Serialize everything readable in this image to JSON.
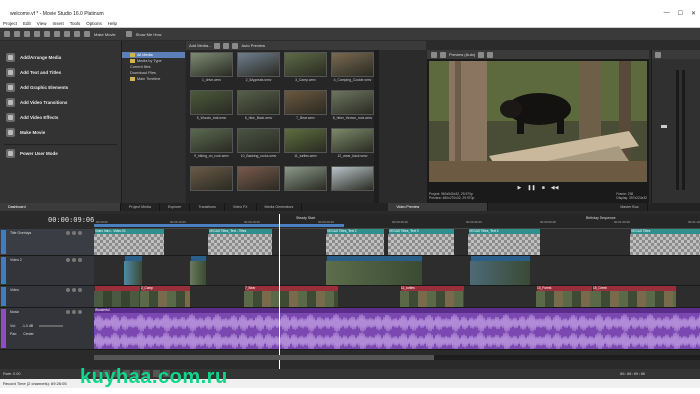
{
  "window": {
    "title": "welcome.vf * - Movie Studio 16.0 Platinum"
  },
  "menu": [
    "Project",
    "Edit",
    "View",
    "Insert",
    "Tools",
    "Options",
    "Help"
  ],
  "toolbar": {
    "make_movie": "Make Movie",
    "show_me_how": "Show Me How"
  },
  "explorer": [
    {
      "label": "Add/Arrange Media",
      "icon": "media-icon"
    },
    {
      "label": "Add Text and Titles",
      "icon": "text-icon"
    },
    {
      "label": "Add Graphic Elements",
      "icon": "graphic-icon"
    },
    {
      "label": "Add Video Transitions",
      "icon": "transition-icon"
    },
    {
      "label": "Add Video Effects",
      "icon": "effects-icon"
    },
    {
      "label": "Make Movie",
      "icon": "film-icon"
    },
    {
      "label": "Power User Mode",
      "icon": "power-icon"
    }
  ],
  "project_media": {
    "add_media": "Add Media...",
    "auto_preview": "Auto Preview",
    "tree": [
      {
        "label": "All Media",
        "selected": true
      },
      {
        "label": "Media by Type",
        "selected": false
      },
      {
        "label": "Current files",
        "selected": false
      },
      {
        "label": "Download Files",
        "selected": false
      },
      {
        "label": "Main Timeline",
        "selected": false
      }
    ],
    "thumbnails": [
      {
        "caption": "1_drive.wmv",
        "color": "#7d8c74"
      },
      {
        "caption": "2_5Appeals.wmv",
        "color": "#6f7f8f"
      },
      {
        "caption": "3_Camp.wmv",
        "color": "#5e6b47"
      },
      {
        "caption": "4_Camping_Cookie.wmv",
        "color": "#7a6a52"
      },
      {
        "caption": "5_Woods_trail.wmv",
        "color": "#4c5a3c"
      },
      {
        "caption": "6_hike_Back.wmv",
        "color": "#56604a"
      },
      {
        "caption": "7_Bear.wmv",
        "color": "#6b5840"
      },
      {
        "caption": "8_hiker_thrown_rock.wmv",
        "color": "#6d7660"
      },
      {
        "caption": "9_hiking_on_rock.wmv",
        "color": "#5a6a50"
      },
      {
        "caption": "10_Backing_rocks.wmv",
        "color": "#4a5444"
      },
      {
        "caption": "11_turtles.wmv",
        "color": "#5e6e3e"
      },
      {
        "caption": "12_wear_back.wmv",
        "color": "#7c8a6a"
      },
      {
        "caption": "",
        "color": "#6a5a48"
      },
      {
        "caption": "",
        "color": "#7a5a4c"
      },
      {
        "caption": "",
        "color": "#8a9a8a"
      },
      {
        "caption": "",
        "color": "#b8c4c8"
      }
    ]
  },
  "preview": {
    "label": "Preview (Auto)",
    "project": "Project: 960x540x32, 29.970p",
    "preview": "Preview: 480x270x32, 29.970p",
    "frame": "Frame: 236",
    "display": "Display: 397x224x32"
  },
  "master_bus": {
    "label": "Master Bus"
  },
  "dock_tabs": [
    "Dashboard",
    "Project Media",
    "Explorer",
    "Transitions",
    "Video FX",
    "Media Generators",
    "Video Preview",
    "Master Bus"
  ],
  "timeline": {
    "time": "00:00:09:06",
    "markers": [
      {
        "label": "Steady Start"
      },
      {
        "label": "Birthday Sequence"
      }
    ],
    "ruler_times": [
      "00:00:00",
      "00:00:10:00",
      "00:00:19:29",
      "00:00:29:29",
      "00:00:39:29",
      "00:00:49:29",
      "00:00:59:28",
      "00:01:09:28",
      "00:01:19:28"
    ],
    "tracks": [
      {
        "name": "Title Overlays",
        "color": "#3d7dc4"
      },
      {
        "name": "Video 2",
        "color": "#3d7dc4"
      },
      {
        "name": "Video",
        "color": "#3d7dc4"
      },
      {
        "name": "Music",
        "color": "#8a4fc4"
      }
    ],
    "title_events": [
      {
        "label": "Video Intro - Video 01",
        "color": "#2f8f8c"
      },
      {
        "label": "VEGAS Titles_Text - Titles",
        "color": "#2f8f8c"
      },
      {
        "label": "VEGAS Titles_Text 2",
        "color": "#2f8f8c"
      },
      {
        "label": "VEGAS Titles_Text 3",
        "color": "#2f8f8c"
      },
      {
        "label": "VEGAS Titles_Text 4",
        "color": "#2f8f8c"
      },
      {
        "label": "VEGAS Titles",
        "color": "#2f8f8c"
      }
    ],
    "video_events": [
      {
        "label": "2_Camp"
      },
      {
        "label": "7_Bear"
      },
      {
        "label": "11_turtles"
      },
      {
        "label": "13_Forest"
      },
      {
        "label": "15_Creek"
      }
    ],
    "music": {
      "label": "Wonderful",
      "vol": "Vol:",
      "vol_value": "-1.0 dB",
      "pan": "Pan:",
      "pan_value": "Center"
    }
  },
  "transport": {
    "rate": "Rate: 0.00",
    "time": "00:00:09:06"
  },
  "status": "Record Time (2 channels): 69:26:05",
  "watermark": "kuyhaa.com.ru"
}
